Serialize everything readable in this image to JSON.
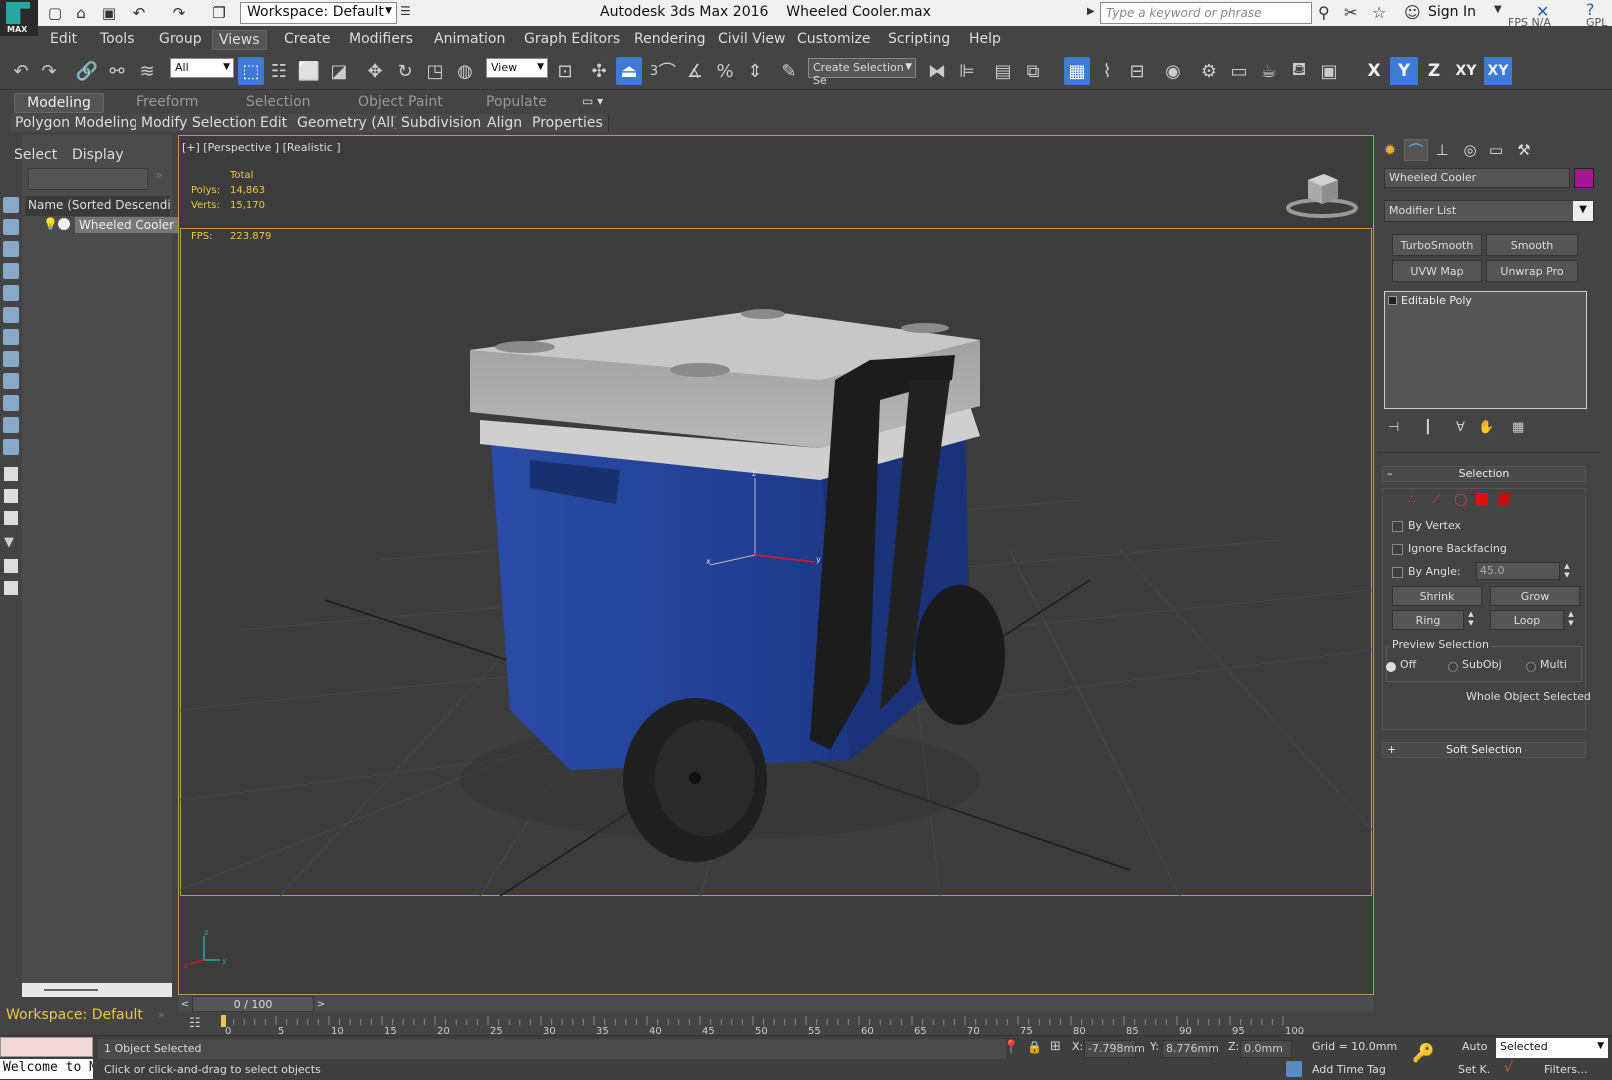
{
  "app": {
    "logo_text": "MAX",
    "workspace": "Workspace: Default",
    "title": "Autodesk 3ds Max 2016",
    "file": "Wheeled Cooler.max",
    "search_placeholder": "Type a keyword or phrase",
    "sign_in": "Sign In",
    "fps_na": "FPS N/A",
    "gpu_label": "GPL"
  },
  "menu": [
    "Edit",
    "Tools",
    "Group",
    "Views",
    "Create",
    "Modifiers",
    "Animation",
    "Graph Editors",
    "Rendering",
    "Civil View",
    "Customize",
    "Scripting",
    "Help"
  ],
  "active_menu": "Views",
  "toolbar": {
    "filter": "All",
    "ref_coord": "View",
    "selection_set": "Create Selection Se",
    "axes": [
      "X",
      "Y",
      "Z",
      "XY",
      "XY"
    ],
    "snap_num": "3"
  },
  "ribbon": {
    "tabs": [
      "Modeling",
      "Freeform",
      "Selection",
      "Object Paint",
      "Populate"
    ],
    "active_tab": "Modeling",
    "subtabs": [
      "Polygon Modeling",
      "Modify Selection",
      "Edit",
      "Geometry (All)",
      "Subdivision",
      "Align",
      "Properties"
    ]
  },
  "scene_explorer": {
    "tabs": [
      "Select",
      "Display"
    ],
    "column_header": "Name (Sorted Descending)",
    "items": [
      "Wheeled Cooler"
    ]
  },
  "viewport": {
    "label": "[+] [Perspective ] [Realistic ]",
    "stats_header": "Total",
    "polys_label": "Polys:",
    "polys": "14,863",
    "verts_label": "Verts:",
    "verts": "15,170",
    "fps_label": "FPS:",
    "fps": "223.879",
    "gizmo_axes": [
      "z",
      "x",
      "y"
    ],
    "mini_axes": [
      "z",
      "x",
      "y"
    ]
  },
  "timeline": {
    "frame": "0 / 100",
    "ticks": [
      "0",
      "5",
      "10",
      "15",
      "20",
      "25",
      "30",
      "35",
      "40",
      "45",
      "50",
      "55",
      "60",
      "65",
      "70",
      "75",
      "80",
      "85",
      "90",
      "95",
      "100"
    ]
  },
  "status": {
    "workspace": "Workspace: Default",
    "welcome": "Welcome to MAXScript.",
    "selected": "1 Object Selected",
    "prompt": "Click or click-and-drag to select objects",
    "x_label": "X:",
    "x": "-7.798mm",
    "y_label": "Y:",
    "y": "8.776mm",
    "z_label": "Z:",
    "z": "0.0mm",
    "grid": "Grid = 10.0mm",
    "add_time_tag": "Add Time Tag",
    "auto": "Auto",
    "set_key": "Set K.",
    "key_filter": "Selected",
    "filters": "Filters..."
  },
  "command_panel": {
    "object_name": "Wheeled Cooler",
    "object_color": "#a0198f",
    "modifier_list": "Modifier List",
    "modifier_buttons": [
      "TurboSmooth",
      "Smooth",
      "UVW Map",
      "Unwrap Pro"
    ],
    "stack": [
      "Editable Poly"
    ],
    "selection_rollout": {
      "title": "Selection",
      "by_vertex": "By Vertex",
      "ignore_backfacing": "Ignore Backfacing",
      "by_angle": "By Angle:",
      "angle_value": "45.0",
      "shrink": "Shrink",
      "grow": "Grow",
      "ring": "Ring",
      "loop": "Loop",
      "preview_selection": "Preview Selection",
      "preview_options": [
        "Off",
        "SubObj",
        "Multi"
      ],
      "preview_selected": "Off",
      "status": "Whole Object Selected"
    },
    "soft_selection": "Soft Selection"
  },
  "colors": {
    "accent": "#3d7bd6",
    "viewport_border": "#b8a238",
    "stat_text": "#e8c84a",
    "cooler_body": "#1f3a8a",
    "cooler_lid": "#a8a8a8"
  }
}
